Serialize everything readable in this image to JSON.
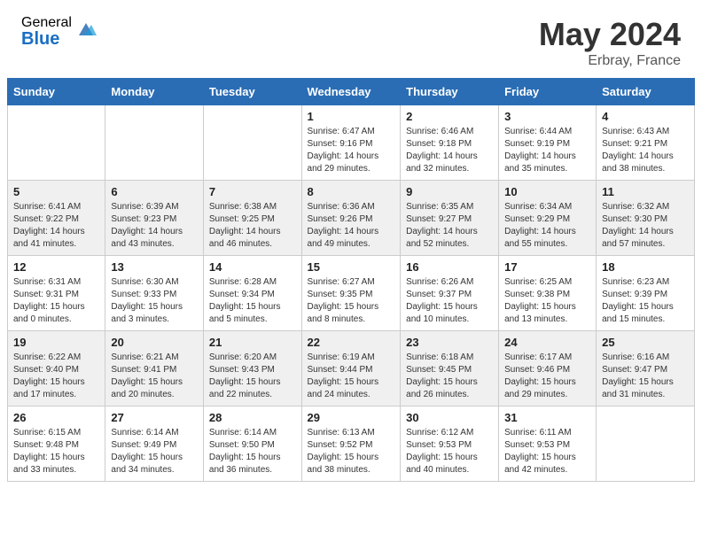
{
  "header": {
    "logo_general": "General",
    "logo_blue": "Blue",
    "title": "May 2024",
    "location": "Erbray, France"
  },
  "days_of_week": [
    "Sunday",
    "Monday",
    "Tuesday",
    "Wednesday",
    "Thursday",
    "Friday",
    "Saturday"
  ],
  "weeks": [
    [
      {
        "day": "",
        "info": ""
      },
      {
        "day": "",
        "info": ""
      },
      {
        "day": "",
        "info": ""
      },
      {
        "day": "1",
        "info": "Sunrise: 6:47 AM\nSunset: 9:16 PM\nDaylight: 14 hours\nand 29 minutes."
      },
      {
        "day": "2",
        "info": "Sunrise: 6:46 AM\nSunset: 9:18 PM\nDaylight: 14 hours\nand 32 minutes."
      },
      {
        "day": "3",
        "info": "Sunrise: 6:44 AM\nSunset: 9:19 PM\nDaylight: 14 hours\nand 35 minutes."
      },
      {
        "day": "4",
        "info": "Sunrise: 6:43 AM\nSunset: 9:21 PM\nDaylight: 14 hours\nand 38 minutes."
      }
    ],
    [
      {
        "day": "5",
        "info": "Sunrise: 6:41 AM\nSunset: 9:22 PM\nDaylight: 14 hours\nand 41 minutes."
      },
      {
        "day": "6",
        "info": "Sunrise: 6:39 AM\nSunset: 9:23 PM\nDaylight: 14 hours\nand 43 minutes."
      },
      {
        "day": "7",
        "info": "Sunrise: 6:38 AM\nSunset: 9:25 PM\nDaylight: 14 hours\nand 46 minutes."
      },
      {
        "day": "8",
        "info": "Sunrise: 6:36 AM\nSunset: 9:26 PM\nDaylight: 14 hours\nand 49 minutes."
      },
      {
        "day": "9",
        "info": "Sunrise: 6:35 AM\nSunset: 9:27 PM\nDaylight: 14 hours\nand 52 minutes."
      },
      {
        "day": "10",
        "info": "Sunrise: 6:34 AM\nSunset: 9:29 PM\nDaylight: 14 hours\nand 55 minutes."
      },
      {
        "day": "11",
        "info": "Sunrise: 6:32 AM\nSunset: 9:30 PM\nDaylight: 14 hours\nand 57 minutes."
      }
    ],
    [
      {
        "day": "12",
        "info": "Sunrise: 6:31 AM\nSunset: 9:31 PM\nDaylight: 15 hours\nand 0 minutes."
      },
      {
        "day": "13",
        "info": "Sunrise: 6:30 AM\nSunset: 9:33 PM\nDaylight: 15 hours\nand 3 minutes."
      },
      {
        "day": "14",
        "info": "Sunrise: 6:28 AM\nSunset: 9:34 PM\nDaylight: 15 hours\nand 5 minutes."
      },
      {
        "day": "15",
        "info": "Sunrise: 6:27 AM\nSunset: 9:35 PM\nDaylight: 15 hours\nand 8 minutes."
      },
      {
        "day": "16",
        "info": "Sunrise: 6:26 AM\nSunset: 9:37 PM\nDaylight: 15 hours\nand 10 minutes."
      },
      {
        "day": "17",
        "info": "Sunrise: 6:25 AM\nSunset: 9:38 PM\nDaylight: 15 hours\nand 13 minutes."
      },
      {
        "day": "18",
        "info": "Sunrise: 6:23 AM\nSunset: 9:39 PM\nDaylight: 15 hours\nand 15 minutes."
      }
    ],
    [
      {
        "day": "19",
        "info": "Sunrise: 6:22 AM\nSunset: 9:40 PM\nDaylight: 15 hours\nand 17 minutes."
      },
      {
        "day": "20",
        "info": "Sunrise: 6:21 AM\nSunset: 9:41 PM\nDaylight: 15 hours\nand 20 minutes."
      },
      {
        "day": "21",
        "info": "Sunrise: 6:20 AM\nSunset: 9:43 PM\nDaylight: 15 hours\nand 22 minutes."
      },
      {
        "day": "22",
        "info": "Sunrise: 6:19 AM\nSunset: 9:44 PM\nDaylight: 15 hours\nand 24 minutes."
      },
      {
        "day": "23",
        "info": "Sunrise: 6:18 AM\nSunset: 9:45 PM\nDaylight: 15 hours\nand 26 minutes."
      },
      {
        "day": "24",
        "info": "Sunrise: 6:17 AM\nSunset: 9:46 PM\nDaylight: 15 hours\nand 29 minutes."
      },
      {
        "day": "25",
        "info": "Sunrise: 6:16 AM\nSunset: 9:47 PM\nDaylight: 15 hours\nand 31 minutes."
      }
    ],
    [
      {
        "day": "26",
        "info": "Sunrise: 6:15 AM\nSunset: 9:48 PM\nDaylight: 15 hours\nand 33 minutes."
      },
      {
        "day": "27",
        "info": "Sunrise: 6:14 AM\nSunset: 9:49 PM\nDaylight: 15 hours\nand 34 minutes."
      },
      {
        "day": "28",
        "info": "Sunrise: 6:14 AM\nSunset: 9:50 PM\nDaylight: 15 hours\nand 36 minutes."
      },
      {
        "day": "29",
        "info": "Sunrise: 6:13 AM\nSunset: 9:52 PM\nDaylight: 15 hours\nand 38 minutes."
      },
      {
        "day": "30",
        "info": "Sunrise: 6:12 AM\nSunset: 9:53 PM\nDaylight: 15 hours\nand 40 minutes."
      },
      {
        "day": "31",
        "info": "Sunrise: 6:11 AM\nSunset: 9:53 PM\nDaylight: 15 hours\nand 42 minutes."
      },
      {
        "day": "",
        "info": ""
      }
    ]
  ]
}
